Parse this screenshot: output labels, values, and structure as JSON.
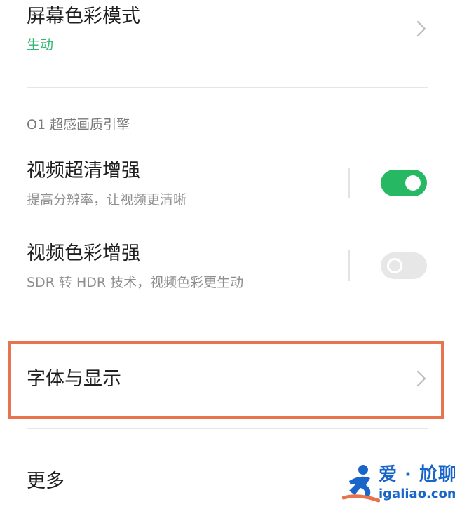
{
  "screen_color_mode": {
    "title": "屏幕色彩模式",
    "value": "生动"
  },
  "o1_engine_section": {
    "header": "O1 超感画质引擎",
    "items": [
      {
        "title": "视频超清增强",
        "subtitle": "提高分辨率，让视频更清晰",
        "enabled": true
      },
      {
        "title": "视频色彩增强",
        "subtitle": "SDR 转 HDR 技术，视频色彩更生动",
        "enabled": false
      }
    ]
  },
  "font_display": {
    "title": "字体与显示"
  },
  "more": {
    "title": "更多"
  },
  "watermark": {
    "name": "爱 · 尬聊",
    "url": "igaliao.com"
  },
  "colors": {
    "accent": "#2fb86f",
    "toggle_on": "#27b863",
    "highlight_border": "#e8734f",
    "watermark": "#1a66c8"
  }
}
